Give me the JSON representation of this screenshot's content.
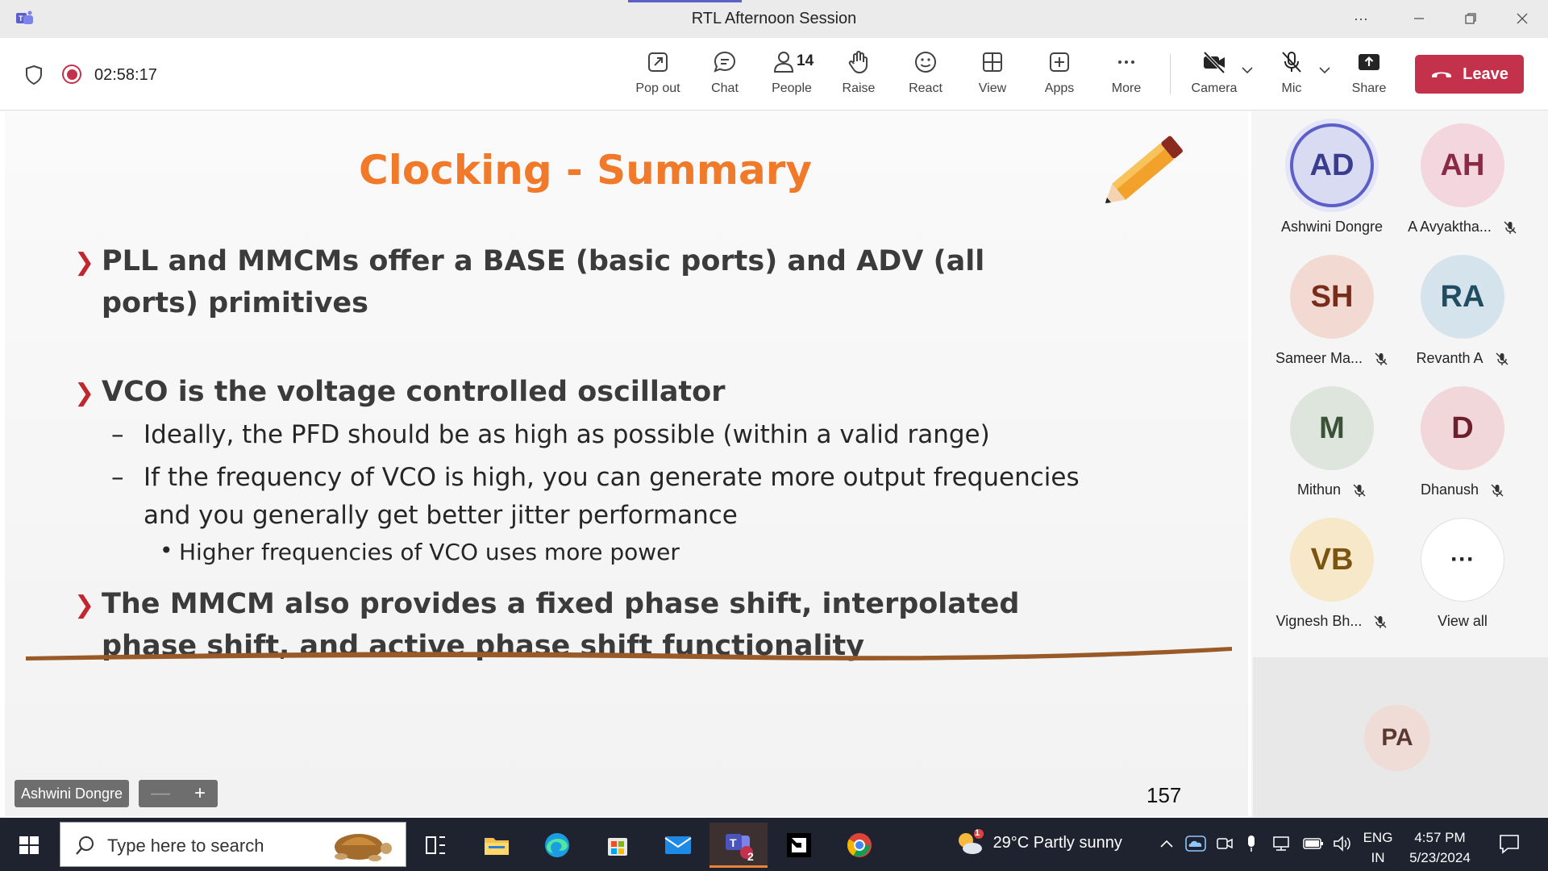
{
  "window": {
    "title": "RTL Afternoon Session",
    "more_glyph": "···"
  },
  "toolbar": {
    "elapsed_time": "02:58:17",
    "buttons": {
      "pop_out": "Pop out",
      "chat": "Chat",
      "people": "People",
      "people_count": "14",
      "raise": "Raise",
      "react": "React",
      "view": "View",
      "apps": "Apps",
      "more": "More",
      "camera": "Camera",
      "mic": "Mic",
      "share": "Share",
      "leave": "Leave"
    }
  },
  "slide": {
    "title": "Clocking - Summary",
    "bullet1": "PLL and MMCMs offer a BASE (basic ports) and ADV (all ports) primitives",
    "bullet2": "VCO is the voltage controlled oscillator",
    "sub1": "Ideally, the PFD should be as high as possible (within a valid range)",
    "sub2": "If the frequency of VCO is high, you can generate more output frequencies and you generally get better jitter performance",
    "subsub1": "Higher frequencies of VCO uses more power",
    "bullet3": "The MMCM also provides a fixed phase shift, interpolated phase shift, and active phase shift functionality",
    "page_number": "157",
    "dash_glyph": "–",
    "dot_glyph": "•",
    "arrow_glyph": "❯"
  },
  "presenter_tag": "Ashwini Dongre",
  "zoom": {
    "minus": "—",
    "plus": "+"
  },
  "participants": [
    {
      "initials": "AD",
      "name": "Ashwini Dongre",
      "muted": false,
      "bg": "#d9dbf3",
      "fg": "#3a3d8f",
      "speaking": true
    },
    {
      "initials": "AH",
      "name": "A Avyaktha...",
      "muted": true,
      "bg": "#f3d6de",
      "fg": "#8a2a45"
    },
    {
      "initials": "SH",
      "name": "Sameer Ma...",
      "muted": true,
      "bg": "#f2d9d2",
      "fg": "#7a2c1a"
    },
    {
      "initials": "RA",
      "name": "Revanth A",
      "muted": true,
      "bg": "#d5e4ec",
      "fg": "#214d63"
    },
    {
      "initials": "M",
      "name": "Mithun",
      "muted": true,
      "bg": "#dde5dc",
      "fg": "#3b5236"
    },
    {
      "initials": "D",
      "name": "Dhanush",
      "muted": true,
      "bg": "#f1d6da",
      "fg": "#6e1f2c"
    },
    {
      "initials": "VB",
      "name": "Vignesh Bh...",
      "muted": true,
      "bg": "#f6e8c8",
      "fg": "#7a5410"
    },
    {
      "initials": "···",
      "name": "View all",
      "muted": false,
      "bg": "#ffffff",
      "fg": "#242424"
    }
  ],
  "extra_participant": "PA",
  "taskbar": {
    "search_placeholder": "Type here to search",
    "weather": "29°C  Partly sunny",
    "weather_badge": "1",
    "teams_badge": "2",
    "lang_top": "ENG",
    "lang_bottom": "IN",
    "time": "4:57 PM",
    "date": "5/23/2024"
  }
}
